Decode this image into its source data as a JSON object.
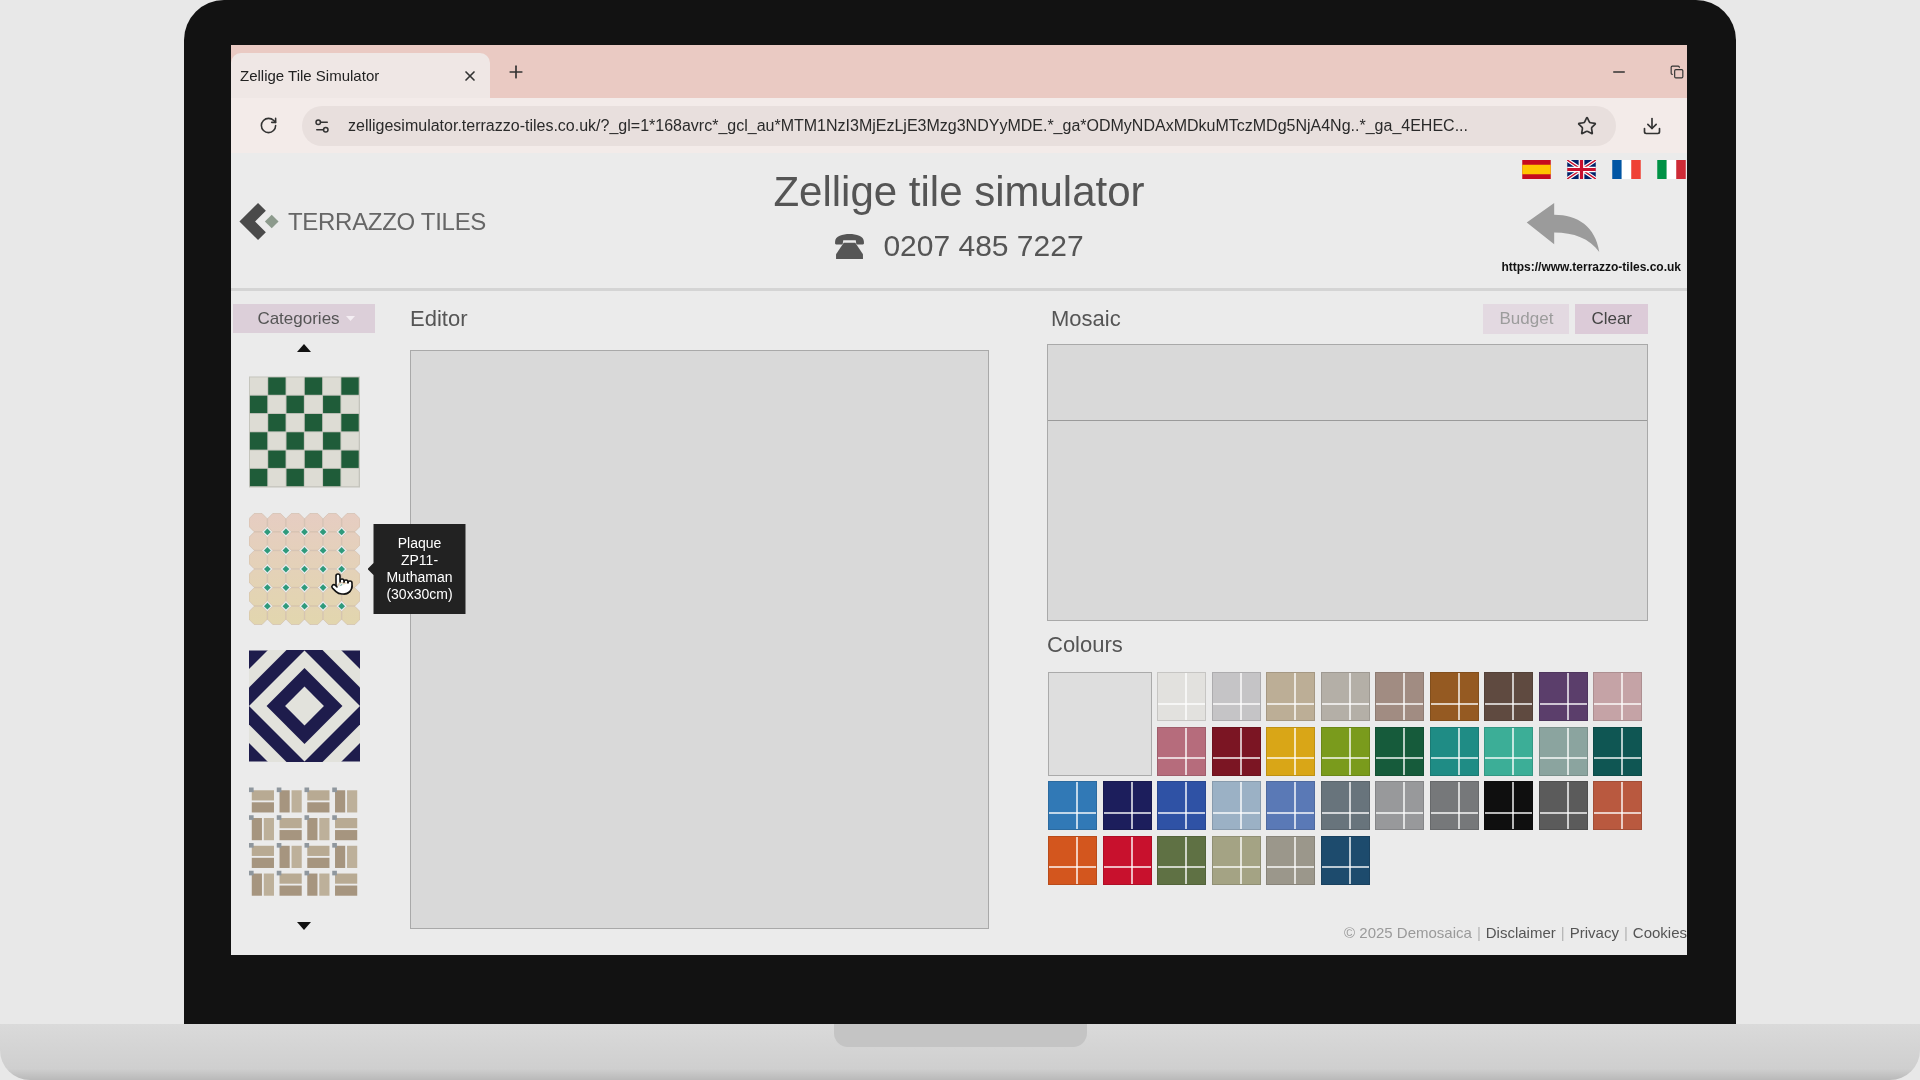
{
  "browser": {
    "tab": {
      "title": "Zellige Tile Simulator"
    },
    "url": "zelligesimulator.terrazzo-tiles.co.uk/?_gl=1*168avrc*_gcl_au*MTM1NzI3MjEzLjE3Mzg3NDYyMDE.*_ga*ODMyNDAxMDkuMTczMDg5NjA4Ng..*_ga_4EHEC..."
  },
  "header": {
    "logo": "TERRAZZO TILES",
    "title": "Zellige tile simulator",
    "phone": "0207 485 7227",
    "languages": [
      {
        "kind": "es"
      },
      {
        "kind": "gb"
      },
      {
        "kind": "fr"
      },
      {
        "kind": "it"
      }
    ],
    "website_link": "https://www.terrazzo-tiles.co.uk"
  },
  "sidebar": {
    "categories_button": "Categories",
    "tiles": [
      {
        "kind": "checkerboard"
      },
      {
        "kind": "octagon",
        "tooltip": "Plaque ZP11-Muthaman (30x30cm)"
      },
      {
        "kind": "diamond"
      },
      {
        "kind": "basketweave"
      }
    ]
  },
  "editor": {
    "title": "Editor"
  },
  "mosaic": {
    "title": "Mosaic",
    "buttons": [
      {
        "label": "Budget",
        "disabled": true
      },
      {
        "label": "Clear",
        "disabled": false
      }
    ]
  },
  "colours": {
    "title": "Colours",
    "swatches": [
      {
        "color": "#e2e1de"
      },
      {
        "color": "#c5c4c6"
      },
      {
        "color": "#bcae96"
      },
      {
        "color": "#b4afa7"
      },
      {
        "color": "#a18c82"
      },
      {
        "color": "#955a22"
      },
      {
        "color": "#5f4a40"
      },
      {
        "color": "#5b3e6b"
      },
      {
        "color": "#c5a3a6"
      },
      {
        "color": "#b66c7c"
      },
      {
        "color": "#7b1523"
      },
      {
        "color": "#d9a617"
      },
      {
        "color": "#7a9b1c"
      },
      {
        "color": "#165b3b"
      },
      {
        "color": "#1f8c85"
      },
      {
        "color": "#3cae97"
      },
      {
        "color": "#8ba49f"
      },
      {
        "color": "#0f5653"
      },
      {
        "color": "#3179b6"
      },
      {
        "color": "#1c1e5c"
      },
      {
        "color": "#2f52a5"
      },
      {
        "color": "#9bb1c5"
      },
      {
        "color": "#5a79b6"
      },
      {
        "color": "#68747c"
      },
      {
        "color": "#98999b"
      },
      {
        "color": "#76787a"
      },
      {
        "color": "#0f0f0f"
      },
      {
        "color": "#5b5b5b"
      },
      {
        "color": "#b9593f"
      },
      {
        "color": "#d3561e"
      },
      {
        "color": "#c8112d"
      },
      {
        "color": "#5f7144"
      },
      {
        "color": "#a4a384"
      },
      {
        "color": "#9b978b"
      },
      {
        "color": "#1d4b6d"
      }
    ]
  },
  "footer": [
    {
      "kind": "text",
      "label": "© 2025 Demosaica"
    },
    {
      "kind": "separator",
      "label": "|"
    },
    {
      "kind": "link",
      "label": "Disclaimer"
    },
    {
      "kind": "separator",
      "label": "|"
    },
    {
      "kind": "link",
      "label": "Privacy"
    },
    {
      "kind": "separator",
      "label": "|"
    },
    {
      "kind": "link",
      "label": "Cookies"
    }
  ]
}
